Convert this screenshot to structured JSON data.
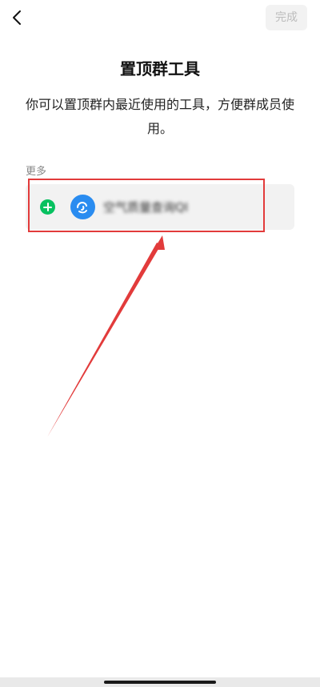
{
  "header": {
    "done_label": "完成"
  },
  "page": {
    "title": "置顶群工具",
    "description": "你可以置顶群内最近使用的工具，方便群成员使用。"
  },
  "section": {
    "label": "更多",
    "items": [
      {
        "name": "空气质量查询QI",
        "icon": "mini-program-icon"
      }
    ]
  },
  "annotations": {
    "highlight_color": "#e23b3b"
  },
  "colors": {
    "add_green": "#07c160",
    "app_blue": "#2a8cf0"
  }
}
